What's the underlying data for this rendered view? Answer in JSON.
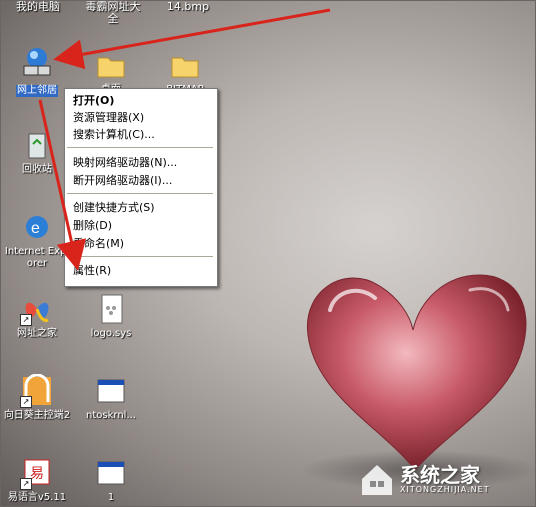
{
  "top_icons": [
    "我的电脑",
    "毒霸网址大全",
    "14.bmp"
  ],
  "icons": {
    "network": "网上邻居",
    "folder1": "桌面",
    "folder2": "BITMAP",
    "recycle": "回收站",
    "ie": "Internet Explorer",
    "site": "网址之家",
    "logo": "logo.sys",
    "sunflower": "向日葵主控端2",
    "ntos": "ntoskrnl...",
    "yiyuyan": "易语言v5.11",
    "file1": "1"
  },
  "context_menu": {
    "open": "打开(O)",
    "explorer": "资源管理器(X)",
    "search_computer": "搜索计算机(C)...",
    "map_drive": "映射网络驱动器(N)...",
    "disconnect_drive": "断开网络驱动器(I)...",
    "create_shortcut": "创建快捷方式(S)",
    "delete": "删除(D)",
    "rename": "重命名(M)",
    "properties": "属性(R)"
  },
  "watermark": {
    "title": "系统之家",
    "url": "XITONGZHIJIA.NET"
  },
  "colors": {
    "selection": "#316ac5",
    "arrow": "#d9241c",
    "menu_bg": "#ffffff"
  }
}
